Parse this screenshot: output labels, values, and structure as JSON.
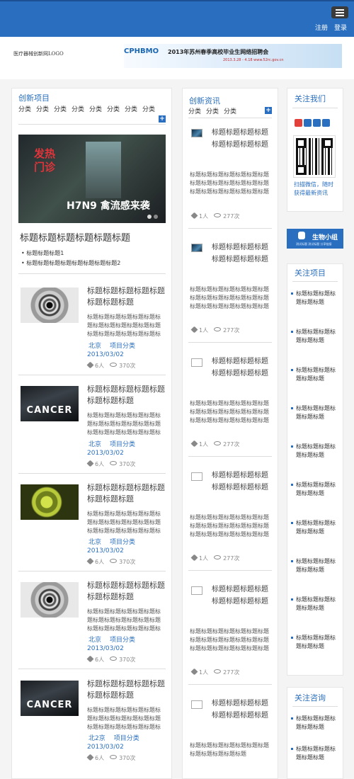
{
  "header": {
    "register": "注册",
    "login": "登录"
  },
  "banner": {
    "logo_text": "医疗器械创新网LOGO",
    "ad_logo": "CPHBMO",
    "ad_title": "2013年苏州春季高校毕业生网络招聘会",
    "ad_sub": "2013.3.28 - 4.18  www.52rc.gov.cn"
  },
  "projects": {
    "title": "创新项目",
    "categories": [
      "分类",
      "分类",
      "分类",
      "分类",
      "分类",
      "分类",
      "分类",
      "分类"
    ],
    "plus": "+",
    "hero_sign": "发热门诊",
    "hero_caption": "H7N9 禽流感来袭",
    "headline": "标题标题标题标题标题标题",
    "bullets": [
      "标题标题标题1",
      "标题标题标题标题标题标题标题标题2"
    ],
    "items": [
      {
        "image": "eye",
        "title": "标题标题标题标题标题标题标题标题",
        "text": "标题标题标题标题标题标题标题标题标题标题标题标题标题标题标题标题标题标题标题标题",
        "city": "北京",
        "cat": "项目分类",
        "date": "2013/03/02",
        "likes": "6人",
        "views": "370次"
      },
      {
        "image": "cancer",
        "title": "标题标题标题标题标题标题标题标题",
        "text": "标题标题标题标题标题标题标题标题标题标题标题标题标题标题标题标题标题标题标题标题",
        "city": "北京",
        "cat": "项目分类",
        "date": "2013/03/02",
        "likes": "6人",
        "views": "370次"
      },
      {
        "image": "virus",
        "title": "标题标题标题标题标题标题标题标题",
        "text": "标题标题标题标题标题标题标题标题标题标题标题标题标题标题标题标题标题标题标题标题",
        "city": "北京",
        "cat": "项目分类",
        "date": "2013/03/02",
        "likes": "6人",
        "views": "370次"
      },
      {
        "image": "eye",
        "title": "标题标题标题标题标题标题标题标题",
        "text": "标题标题标题标题标题标题标题标题标题标题标题标题标题标题标题标题标题标题标题标题",
        "city": "北京",
        "cat": "项目分类",
        "date": "2013/03/02",
        "likes": "6人",
        "views": "370次"
      },
      {
        "image": "cancer",
        "title": "标题标题标题标题标题标题标题标题",
        "text": "标题标题标题标题标题标题标题标题标题标题标题标题标题标题标题标题标题标题标题标题",
        "city": "北2京",
        "cat": "项目分类",
        "date": "2013/03/02",
        "likes": "6人",
        "views": "370次"
      }
    ],
    "cancer_word": "CANCER"
  },
  "news": {
    "title": "创新资讯",
    "categories": [
      "分类",
      "分类",
      "分类"
    ],
    "plus": "+",
    "items": [
      {
        "title": "标题标题标题标题标题标题标题标题",
        "text": "标题标题标题标题标题标题标题标题标题标题标题标题标题标题标题标题标题标题标题标题标题",
        "likes": "1人",
        "views": "277次"
      },
      {
        "title": "标题标题标题标题标题标题标题标题",
        "text": "标题标题标题标题标题标题标题标题标题标题标题标题标题标题标题标题标题标题标题标题标题",
        "likes": "1人",
        "views": "277次"
      },
      {
        "title": "标题标题标题标题标题标题标题标题",
        "text": "标题标题标题标题标题标题标题标题标题标题标题标题标题标题标题标题标题标题标题标题标题",
        "likes": "1人",
        "views": "277次"
      },
      {
        "title": "标题标题标题标题标题标题标题标题",
        "text": "标题标题标题标题标题标题标题标题标题标题标题标题标题标题标题标题标题标题标题标题标题",
        "likes": "1人",
        "views": "277次"
      },
      {
        "title": "标题标题标题标题标题标题标题标题",
        "text": "标题标题标题标题标题标题标题标题标题标题标题标题标题标题标题标题标题标题标题标题标题",
        "likes": "1人",
        "views": "277次"
      },
      {
        "title": "标题标题标题标题标题标题标题标题",
        "text": "标题标题标题标题标题标题标题标题标题标题标题标题",
        "likes": "",
        "views": ""
      }
    ]
  },
  "follow": {
    "title": "关注我们",
    "wechat_text": "扫描微信，随时获得最新资讯",
    "bio_label": "生物小组",
    "bio_sub": "测试标题  测试标题  分享链接"
  },
  "follow_projects": {
    "title": "关注项目",
    "items": [
      "标题标题标题标题标题标题",
      "标题标题标题标题标题标题",
      "标题标题标题标题标题标题",
      "标题标题标题标题标题标题",
      "标题标题标题标题标题标题",
      "标题标题标题标题标题标题",
      "标题标题标题标题标题标题",
      "标题标题标题标题标题标题",
      "标题标题标题标题标题标题",
      "标题标题标题标题标题标题"
    ]
  },
  "follow_news": {
    "title": "关注咨询",
    "items": [
      "标题标题标题标题标题标题",
      "标题标题标题标题标题标题"
    ]
  },
  "colors": {
    "brand": "#2a6fbf",
    "menu_btn": "#3a3a3a"
  }
}
